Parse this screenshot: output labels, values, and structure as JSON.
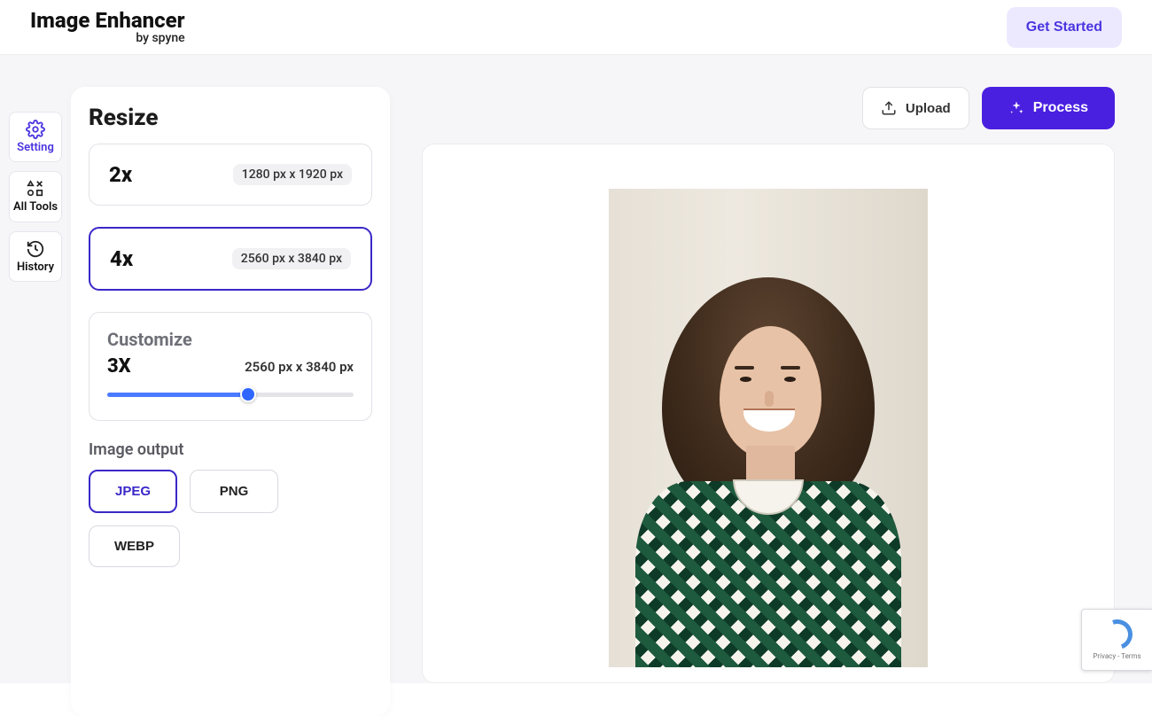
{
  "header": {
    "logo_title": "Image Enhancer",
    "logo_sub": "by spyne",
    "get_started": "Get Started"
  },
  "sidebar": {
    "items": [
      {
        "label": "Setting"
      },
      {
        "label": "All Tools"
      },
      {
        "label": "History"
      }
    ]
  },
  "actions": {
    "upload": "Upload",
    "process": "Process"
  },
  "panel": {
    "title": "Resize",
    "options": [
      {
        "mult": "2x",
        "dims": "1280 px x 1920 px"
      },
      {
        "mult": "4x",
        "dims": "2560 px x 3840 px"
      }
    ],
    "customize": {
      "title": "Customize",
      "mult": "3X",
      "dims": "2560 px x 3840 px"
    },
    "output_title": "Image output",
    "formats": [
      {
        "label": "JPEG"
      },
      {
        "label": "PNG"
      },
      {
        "label": "WEBP"
      }
    ]
  },
  "recaptcha": {
    "text": "Privacy - Terms"
  }
}
